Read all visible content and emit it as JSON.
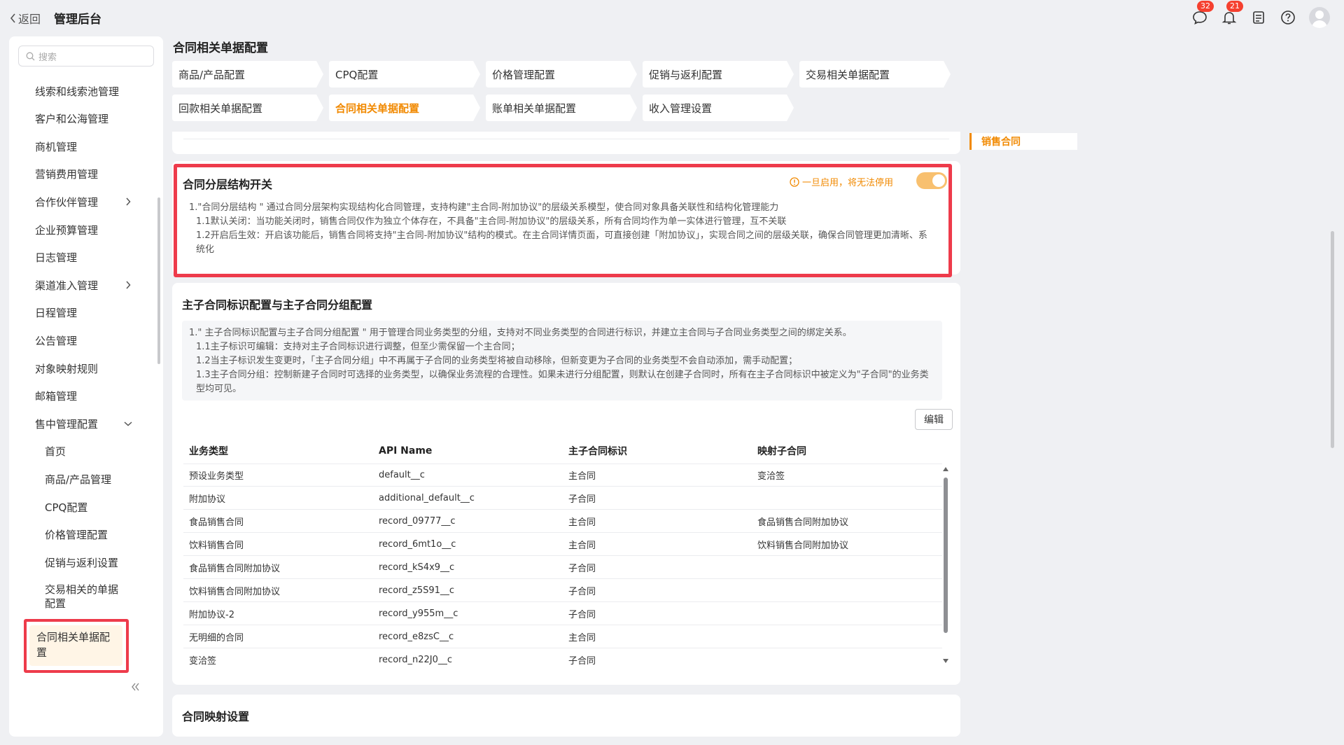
{
  "topbar": {
    "back_label": "返回",
    "app_title": "管理后台",
    "messages_badge": "32",
    "notifications_badge": "21"
  },
  "sidebar": {
    "search_placeholder": "搜索",
    "items": [
      {
        "label": "线索和线索池管理"
      },
      {
        "label": "客户和公海管理"
      },
      {
        "label": "商机管理"
      },
      {
        "label": "营销费用管理"
      },
      {
        "label": "合作伙伴管理"
      },
      {
        "label": "企业预算管理"
      },
      {
        "label": "日志管理"
      },
      {
        "label": "渠道准入管理"
      },
      {
        "label": "日程管理"
      },
      {
        "label": "公告管理"
      },
      {
        "label": "对象映射规则"
      },
      {
        "label": "邮箱管理"
      },
      {
        "label": "售中管理配置"
      }
    ],
    "sub_items": [
      {
        "label": "首页"
      },
      {
        "label": "商品/产品管理"
      },
      {
        "label": "CPQ配置"
      },
      {
        "label": "价格管理配置"
      },
      {
        "label": "促销与返利设置"
      },
      {
        "label": "交易相关的单据配置"
      },
      {
        "label": "回款相关单据配置"
      },
      {
        "label": "合同相关单据配置"
      }
    ]
  },
  "page": {
    "title": "合同相关单据配置",
    "tabs": [
      {
        "label": "商品/产品配置"
      },
      {
        "label": "CPQ配置"
      },
      {
        "label": "价格管理配置"
      },
      {
        "label": "促销与返利配置"
      },
      {
        "label": "交易相关单据配置"
      },
      {
        "label": "回款相关单据配置"
      },
      {
        "label": "合同相关单据配置"
      },
      {
        "label": "账单相关单据配置"
      },
      {
        "label": "收入管理设置"
      }
    ],
    "anchor_label": "销售合同"
  },
  "hierarchy": {
    "title": "合同分层结构开关",
    "warning": "一旦启用，将无法停用",
    "toggle_on": true,
    "lines": [
      "1.\"合同分层结构 \" 通过合同分层架构实现结构化合同管理，支持构建\"主合同-附加协议\"的层级关系模型，使合同对象具备关联性和结构化管理能力",
      "1.1默认关闭：当功能关闭时，销售合同仅作为独立个体存在，不具备\"主合同-附加协议\"的层级关系，所有合同均作为单一实体进行管理，互不关联",
      "1.2开启后生效：开启该功能后，销售合同将支持\"主合同-附加协议\"结构的模式。在主合同详情页面，可直接创建「附加协议」，实现合同之间的层级关联，确保合同管理更加清晰、系统化"
    ]
  },
  "identity": {
    "title": "主子合同标识配置与主子合同分组配置",
    "lines": [
      "1.\" 主子合同标识配置与主子合同分组配置 \" 用于管理合同业务类型的分组，支持对不同业务类型的合同进行标识，并建立主合同与子合同业务类型之间的绑定关系。",
      "1.1主子标识可编辑：支持对主子合同标识进行调整，但至少需保留一个主合同；",
      "1.2当主子标识发生变更时，「主子合同分组」中不再属于子合同的业务类型将被自动移除，但新变更为子合同的业务类型不会自动添加，需手动配置；",
      "1.3主子合同分组：控制新建子合同时可选择的业务类型，以确保业务流程的合理性。如果未进行分组配置，则默认在创建子合同时，所有在主子合同标识中被定义为\"子合同\"的业务类型均可见。"
    ],
    "edit_label": "编辑",
    "columns": [
      "业务类型",
      "API Name",
      "主子合同标识",
      "映射子合同"
    ],
    "rows": [
      [
        "预设业务类型",
        "default__c",
        "主合同",
        "变洽签"
      ],
      [
        "附加协议",
        "additional_default__c",
        "子合同",
        ""
      ],
      [
        "食品销售合同",
        "record_09777__c",
        "主合同",
        "食品销售合同附加协议"
      ],
      [
        "饮料销售合同",
        "record_6mt1o__c",
        "主合同",
        "饮料销售合同附加协议"
      ],
      [
        "食品销售合同附加协议",
        "record_kS4x9__c",
        "子合同",
        ""
      ],
      [
        "饮料销售合同附加协议",
        "record_z5S91__c",
        "子合同",
        ""
      ],
      [
        "附加协议-2",
        "record_y955m__c",
        "子合同",
        ""
      ],
      [
        "无明细的合同",
        "record_e8zsC__c",
        "主合同",
        ""
      ],
      [
        "变洽签",
        "record_n22J0__c",
        "子合同",
        ""
      ]
    ]
  },
  "mapping": {
    "title": "合同映射设置"
  },
  "colors": {
    "accent": "#f18900",
    "highlight_frame": "#ee3b4b",
    "badge": "#f5402f"
  }
}
